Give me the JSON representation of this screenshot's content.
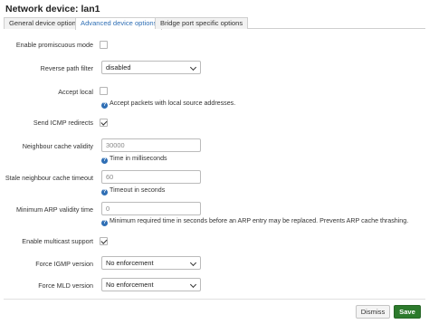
{
  "title": "Network device: lan1",
  "tabs": [
    {
      "label": "General device options"
    },
    {
      "label": "Advanced device options"
    },
    {
      "label": "Bridge port specific options"
    }
  ],
  "fields": {
    "promisc": {
      "label": "Enable promiscuous mode",
      "checked": false
    },
    "rpfilter": {
      "label": "Reverse path filter",
      "value": "disabled"
    },
    "acceptlocal": {
      "label": "Accept local",
      "checked": false,
      "hint": "Accept packets with local source addresses."
    },
    "sendredirects": {
      "label": "Send ICMP redirects",
      "checked": true
    },
    "neighreachable": {
      "label": "Neighbour cache validity",
      "placeholder": "30000",
      "hint": "Time in milliseconds"
    },
    "neighgcstale": {
      "label": "Stale neighbour cache timeout",
      "placeholder": "60",
      "hint": "Timeout in seconds"
    },
    "neighlocktime": {
      "label": "Minimum ARP validity time",
      "placeholder": "0",
      "hint": "Minimum required time in seconds before an ARP entry may be replaced. Prevents ARP cache thrashing."
    },
    "multicast": {
      "label": "Enable multicast support",
      "checked": true
    },
    "igmpversion": {
      "label": "Force IGMP version",
      "value": "No enforcement"
    },
    "mldversion": {
      "label": "Force MLD version",
      "value": "No enforcement"
    }
  },
  "help_icon_glyph": "?",
  "buttons": {
    "dismiss": "Dismiss",
    "save": "Save"
  },
  "colors": {
    "accent": "#2f6fb5",
    "save": "#2c7a2c"
  }
}
